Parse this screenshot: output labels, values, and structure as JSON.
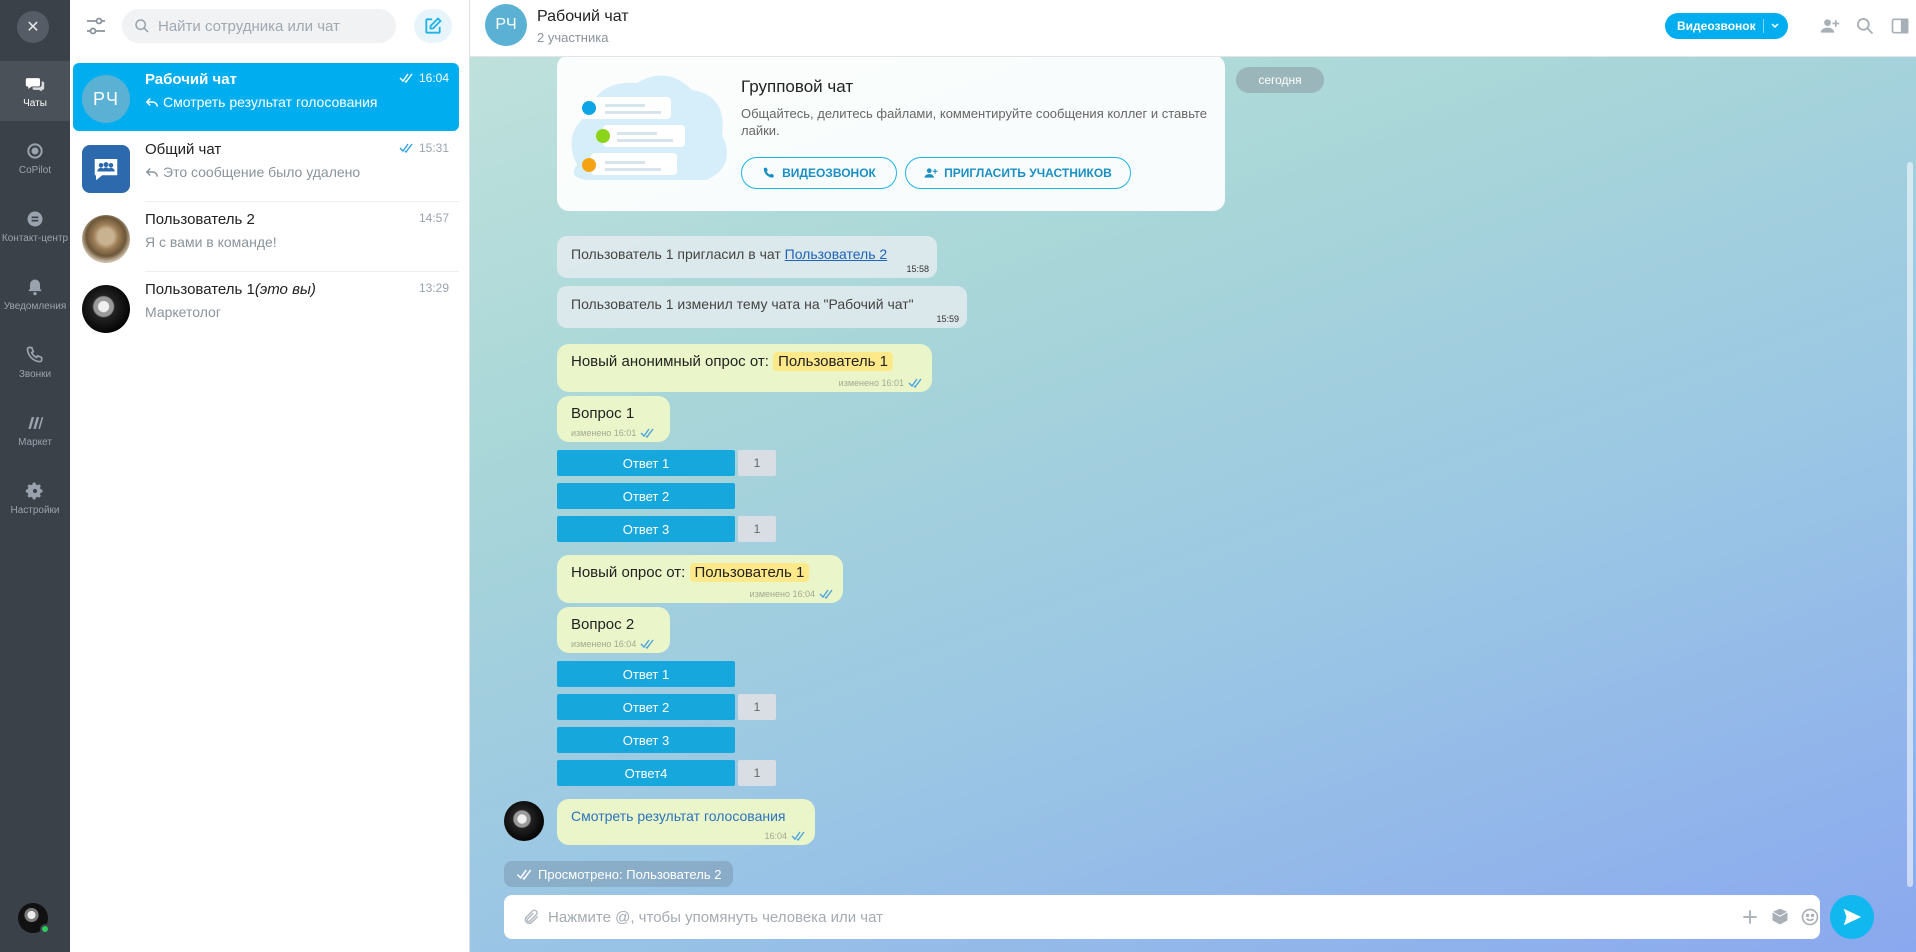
{
  "rail": {
    "items": [
      {
        "label": "Чаты",
        "icon": "chat-icon"
      },
      {
        "label": "CoPilot",
        "icon": "copilot-icon"
      },
      {
        "label": "Контакт-центр",
        "icon": "contact-center-icon"
      },
      {
        "label": "Уведомления",
        "icon": "bell-icon"
      },
      {
        "label": "Звонки",
        "icon": "phone-icon"
      },
      {
        "label": "Маркет",
        "icon": "market-icon"
      },
      {
        "label": "Настройки",
        "icon": "gear-icon"
      }
    ]
  },
  "list": {
    "search_placeholder": "Найти сотрудника или чат",
    "chats": [
      {
        "name": "Рабочий чат",
        "time": "16:04",
        "preview": "Смотреть результат голосования",
        "initials": "РЧ"
      },
      {
        "name": "Общий чат",
        "time": "15:31",
        "preview": "Это сообщение было удалено"
      },
      {
        "name": "Пользователь 2",
        "time": "14:57",
        "preview": "Я с вами в команде!"
      },
      {
        "name": "Пользователь 1",
        "name_suffix": "(это вы)",
        "time": "13:29",
        "preview": "Маркетолог"
      }
    ]
  },
  "header": {
    "initials": "РЧ",
    "title": "Рабочий чат",
    "subtitle": "2 участника",
    "video_button": "Видеозвонок"
  },
  "card": {
    "title": "Групповой чат",
    "text": "Общайтесь, делитесь файлами, комментируйте сообщения коллег и ставьте лайки.",
    "video_button": "ВИДЕОЗВОНОК",
    "invite_button": "ПРИГЛАСИТЬ УЧАСТНИКОВ",
    "date": "сегодня"
  },
  "messages": {
    "sys1_text": "Пользователь 1 пригласил в чат ",
    "sys1_link": "Пользователь 2",
    "sys1_time": "15:58",
    "sys2_text": "Пользователь 1 изменил тему чата на \"Рабочий чат\"",
    "sys2_time": "15:59",
    "poll1_header": "Новый анонимный опрос от:",
    "poll1_author": "Пользователь 1",
    "poll1_meta": "изменено 16:01",
    "poll1_question": "Вопрос 1",
    "poll1_q_meta": "изменено 16:01",
    "poll1_options": [
      {
        "label": "Ответ 1",
        "count": "1"
      },
      {
        "label": "Ответ 2",
        "count": ""
      },
      {
        "label": "Ответ 3",
        "count": "1"
      }
    ],
    "poll2_header": "Новый опрос от:",
    "poll2_author": "Пользователь 1",
    "poll2_meta": "изменено 16:04",
    "poll2_question": "Вопрос 2",
    "poll2_q_meta": "изменено 16:04",
    "poll2_options": [
      {
        "label": "Ответ 1",
        "count": ""
      },
      {
        "label": "Ответ 2",
        "count": "1"
      },
      {
        "label": "Ответ 3",
        "count": ""
      },
      {
        "label": "Ответ4",
        "count": "1"
      }
    ],
    "result_link": "Смотреть результат голосования",
    "result_time": "16:04",
    "seen": "Просмотрено: Пользователь 2"
  },
  "input": {
    "placeholder": "Нажмите @, чтобы упомянуть человека или чат"
  },
  "colors": {
    "accent": "#00aeef",
    "rail": "#3b4149",
    "bubble": "#eaf6c9",
    "highlight": "#fde98a"
  }
}
